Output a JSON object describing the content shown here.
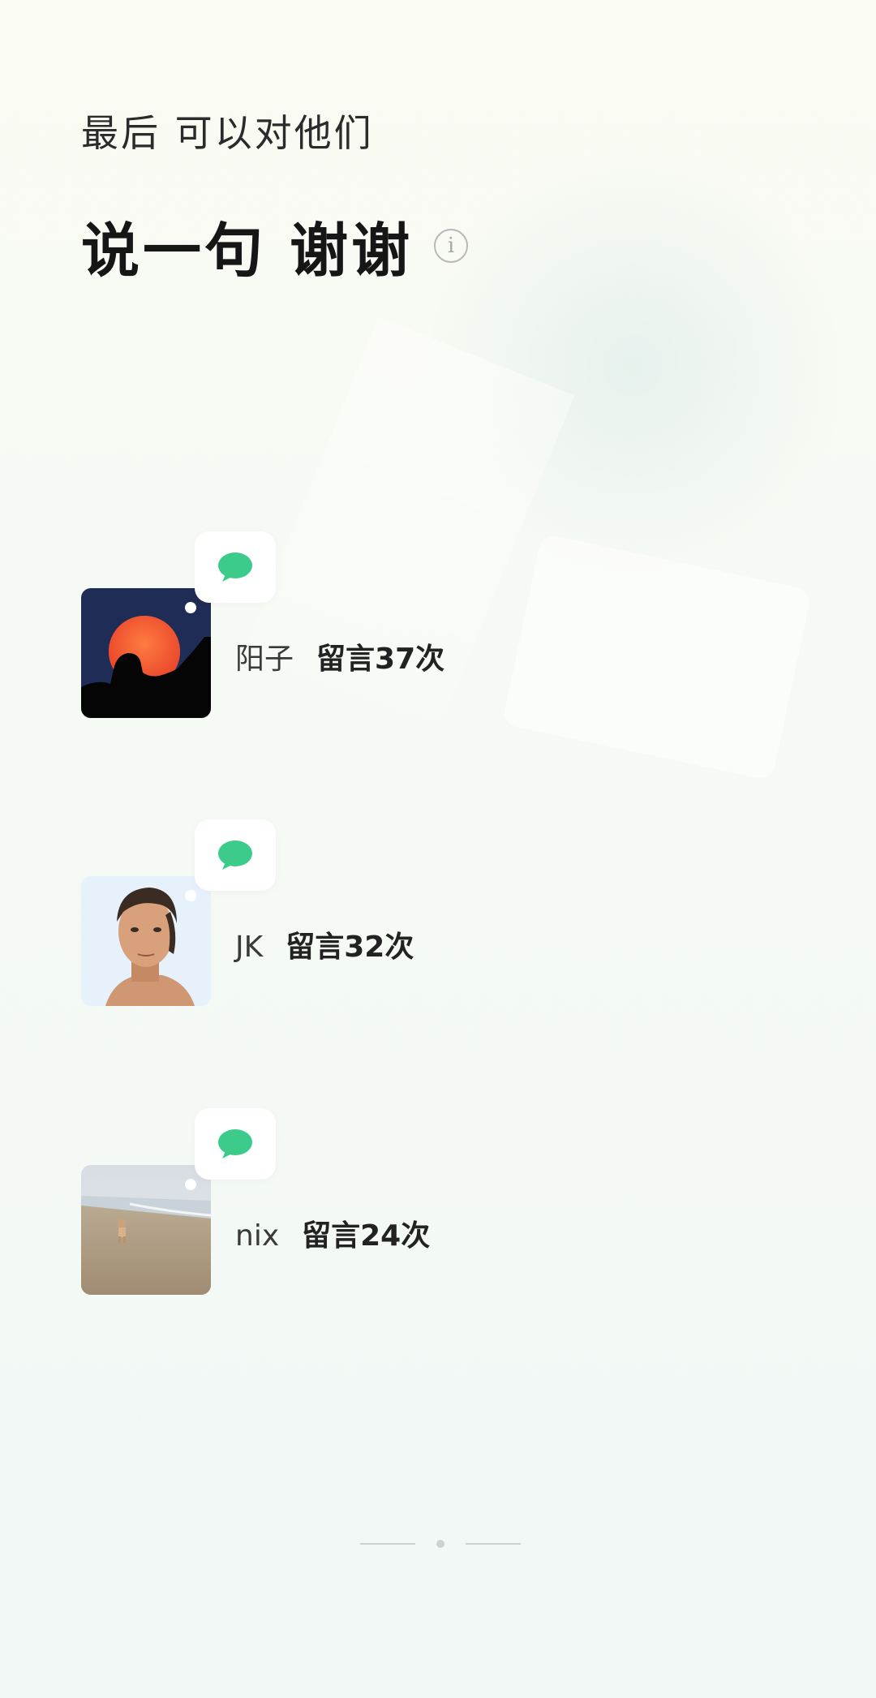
{
  "header": {
    "subtitle": "最后  可以对他们",
    "title": "说一句 谢谢"
  },
  "entries": [
    {
      "name": "阳子",
      "count": "留言37次",
      "avatar": "sunset-silhouette"
    },
    {
      "name": "JK",
      "count": "留言32次",
      "avatar": "portrait-man"
    },
    {
      "name": "nix",
      "count": "留言24次",
      "avatar": "beach-child"
    }
  ],
  "colors": {
    "accent_green": "#3ccb8a",
    "background": "#f6faf4"
  },
  "icons": [
    "info-icon",
    "chat-bubble-icon"
  ],
  "pagination": {
    "pages": 3,
    "current": 2
  }
}
